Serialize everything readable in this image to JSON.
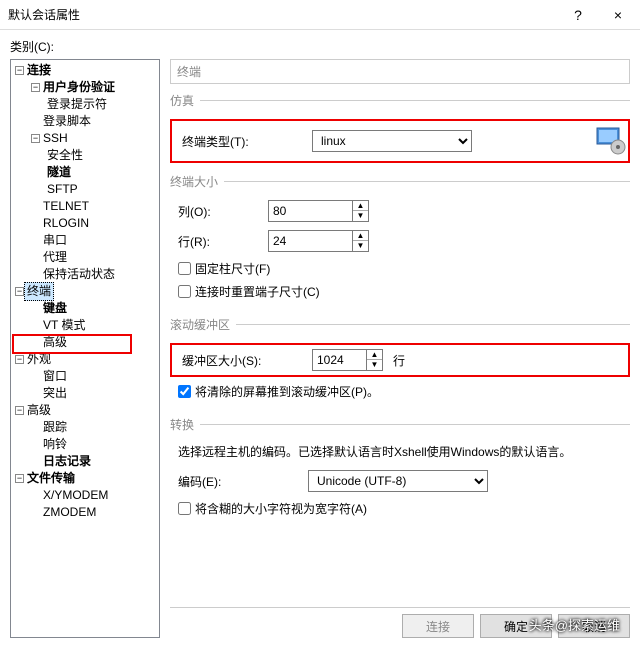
{
  "window": {
    "title": "默认会话属性",
    "help": "?",
    "close": "×"
  },
  "category_label": "类别(C):",
  "tree": {
    "connection": "连接",
    "auth": "用户身份验证",
    "login_prompt": "登录提示符",
    "login_script": "登录脚本",
    "ssh": "SSH",
    "security": "安全性",
    "tunnel": "隧道",
    "sftp": "SFTP",
    "telnet": "TELNET",
    "rlogin": "RLOGIN",
    "serial": "串口",
    "proxy": "代理",
    "keepalive": "保持活动状态",
    "terminal": "终端",
    "keyboard": "键盘",
    "vt": "VT 模式",
    "advanced": "高级",
    "appearance": "外观",
    "window": "窗口",
    "highlight": "突出",
    "adv2": "高级",
    "trace": "跟踪",
    "bell": "响铃",
    "logging": "日志记录",
    "filetransfer": "文件传输",
    "xym": "X/YMODEM",
    "zm": "ZMODEM"
  },
  "header_disabled": "终端",
  "emulation": {
    "legend": "仿真",
    "term_type_label": "终端类型(T):",
    "term_type_value": "linux"
  },
  "termsize": {
    "legend": "终端大小",
    "cols_label": "列(O):",
    "cols_value": "80",
    "rows_label": "行(R):",
    "rows_value": "24",
    "fixed_cols": "固定柱尺寸(F)",
    "reset_on_connect": "连接时重置端子尺寸(C)"
  },
  "scroll": {
    "legend": "滚动缓冲区",
    "buf_label": "缓冲区大小(S):",
    "buf_value": "1024",
    "buf_unit": "行",
    "push_cleared": "将清除的屏幕推到滚动缓冲区(P)。"
  },
  "translate": {
    "legend": "转换",
    "desc": "选择远程主机的编码。已选择默认语言时Xshell使用Windows的默认语言。",
    "encoding_label": "编码(E):",
    "encoding_value": "Unicode (UTF-8)",
    "ambiguous": "将含糊的大小字符视为宽字符(A)"
  },
  "footer": {
    "connect": "连接",
    "ok": "确定",
    "cancel": "取消"
  },
  "watermark": "头条@探索运维"
}
